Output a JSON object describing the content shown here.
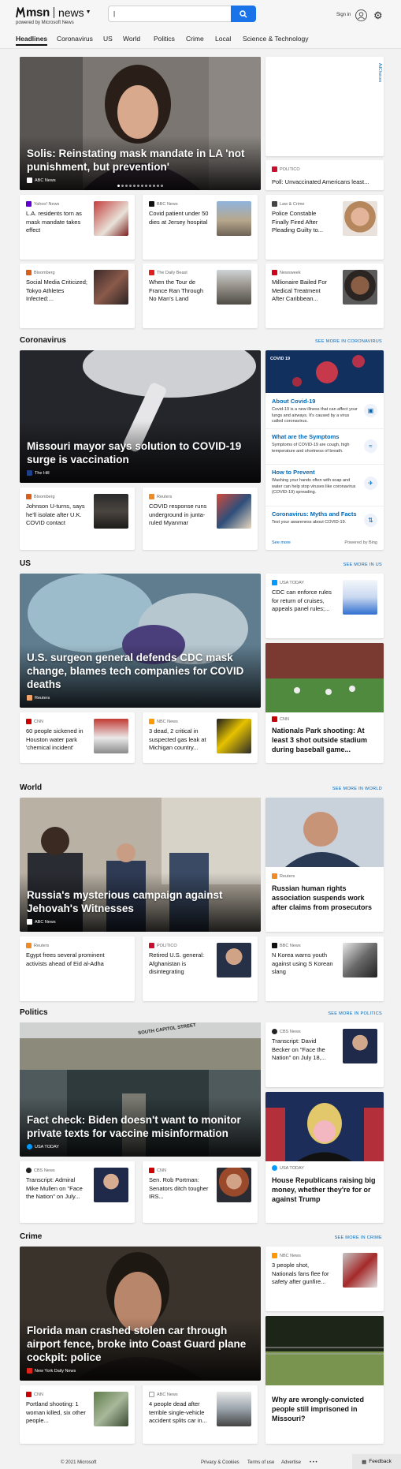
{
  "header": {
    "brand": "msn",
    "section": "news",
    "powered_by": "powered by Microsoft News",
    "search_placeholder": "",
    "signin": "Sign in"
  },
  "nav": [
    "Headlines",
    "Coronavirus",
    "US",
    "World",
    "Politics",
    "Crime",
    "Local",
    "Science & Technology"
  ],
  "headlines": {
    "hero": {
      "title": "Solis: Reinstating mask mandate in LA 'not punishment, but prevention'",
      "source": "ABC News"
    },
    "ad_label": "AdChoices",
    "side": {
      "source": "POLITICO",
      "title": "Poll: Unvaccinated Americans least..."
    },
    "row1": [
      {
        "source": "Yahoo! News",
        "title": "L.A. residents torn as mask mandate takes effect"
      },
      {
        "source": "BBC News",
        "title": "Covid patient under 50 dies at Jersey hospital"
      },
      {
        "source": "Law & Crime",
        "title": "Police Constable Finally Fired After Pleading Guilty to..."
      }
    ],
    "row2": [
      {
        "source": "Bloomberg",
        "title": "Social Media Criticized; Tokyo Athletes Infected:..."
      },
      {
        "source": "The Daily Beast",
        "title": "When the Tour de France Ran Through No Man's Land"
      },
      {
        "source": "Newsweek",
        "title": "Millionaire Bailed For Medical Treatment After Caribbean..."
      }
    ]
  },
  "coronavirus": {
    "heading": "Coronavirus",
    "see_more": "SEE MORE IN CORONAVIRUS",
    "hero": {
      "title": "Missouri mayor says solution to COVID-19 surge is vaccination",
      "source": "The Hill"
    },
    "row": [
      {
        "source": "Bloomberg",
        "title": "Johnson U-turns, says he'll isolate after U.K. COVID contact"
      },
      {
        "source": "Reuters",
        "title": "COVID response runs underground in junta-ruled Myanmar"
      }
    ],
    "panel": {
      "badge": "COVID 19",
      "items": [
        {
          "title": "About Covid-19",
          "desc": "Covid-19 is a new illness that can affect your lungs and airways. It's caused by a virus called coronavirus."
        },
        {
          "title": "What are the Symptoms",
          "desc": "Symptoms of COVID-19 are cough, high temperature and shortness of breath."
        },
        {
          "title": "How to Prevent",
          "desc": "Washing your hands often with soap and water can help stop viruses like coronavirus (COVID-19) spreading."
        },
        {
          "title": "Coronavirus: Myths and Facts",
          "desc": "Test your awareness about COVID-19."
        }
      ],
      "see_more": "See more",
      "powered": "Powered by Bing"
    }
  },
  "us": {
    "heading": "US",
    "see_more": "SEE MORE IN US",
    "hero": {
      "title": "U.S. surgeon general defends CDC mask change, blames tech companies for COVID deaths",
      "source": "Reuters"
    },
    "side1": {
      "source": "USA TODAY",
      "title": "CDC can enforce rules for return of cruises, appeals panel rules;..."
    },
    "side2": {
      "source": "CNN",
      "title": "Nationals Park shooting: At least 3 shot outside stadium during baseball game..."
    },
    "row": [
      {
        "source": "CNN",
        "title": "60 people sickened in Houston water park 'chemical incident'"
      },
      {
        "source": "NBC News",
        "title": "3 dead, 2 critical in suspected gas leak at Michigan country..."
      }
    ]
  },
  "world": {
    "heading": "World",
    "see_more": "SEE MORE IN WORLD",
    "hero": {
      "title": "Russia's mysterious campaign against Jehovah's Witnesses",
      "source": "ABC News"
    },
    "side": {
      "source": "Reuters",
      "title": "Russian human rights association suspends work after claims from prosecutors"
    },
    "row": [
      {
        "source": "Reuters",
        "title": "Egypt frees several prominent activists ahead of Eid al-Adha"
      },
      {
        "source": "POLITICO",
        "title": "Retired U.S. general: Afghanistan is disintegrating"
      },
      {
        "source": "BBC News",
        "title": "N Korea warns youth against using S Korean slang"
      }
    ]
  },
  "politics": {
    "heading": "Politics",
    "see_more": "SEE MORE IN POLITICS",
    "hero": {
      "title": "Fact check: Biden doesn't want to monitor private texts for vaccine misinformation",
      "source": "USA TODAY",
      "sign": "SOUTH CAPITOL STREET"
    },
    "side1": {
      "source": "CBS News",
      "title": "Transcript: David Becker on \"Face the Nation\" on July 18,..."
    },
    "side2": {
      "source": "USA TODAY",
      "title": "House Republicans raising big money, whether they're for or against Trump"
    },
    "row": [
      {
        "source": "CBS News",
        "title": "Transcript: Admiral Mike Mullen on \"Face the Nation\" on July..."
      },
      {
        "source": "CNN",
        "title": "Sen. Rob Portman: Senators ditch tougher IRS..."
      }
    ]
  },
  "crime": {
    "heading": "Crime",
    "see_more": "SEE MORE IN CRIME",
    "hero": {
      "title": "Florida man crashed stolen car through airport fence, broke into Coast Guard plane cockpit: police",
      "source": "New York Daily News"
    },
    "side1": {
      "source": "NBC News",
      "title": "3 people shot, Nationals fans flee for safety after gunfire..."
    },
    "side2": {
      "title": "Why are wrongly-convicted people still imprisoned in Missouri?"
    },
    "row": [
      {
        "source": "CNN",
        "title": "Portland shooting: 1 woman killed, six other people..."
      },
      {
        "source": "ABC News",
        "title": "4 people dead after terrible single-vehicle accident splits car in..."
      }
    ]
  },
  "footer": {
    "copyright": "© 2021 Microsoft",
    "privacy": "Privacy & Cookies",
    "terms": "Terms of use",
    "advertise": "Advertise",
    "more": "• • •",
    "feedback": "Feedback"
  }
}
